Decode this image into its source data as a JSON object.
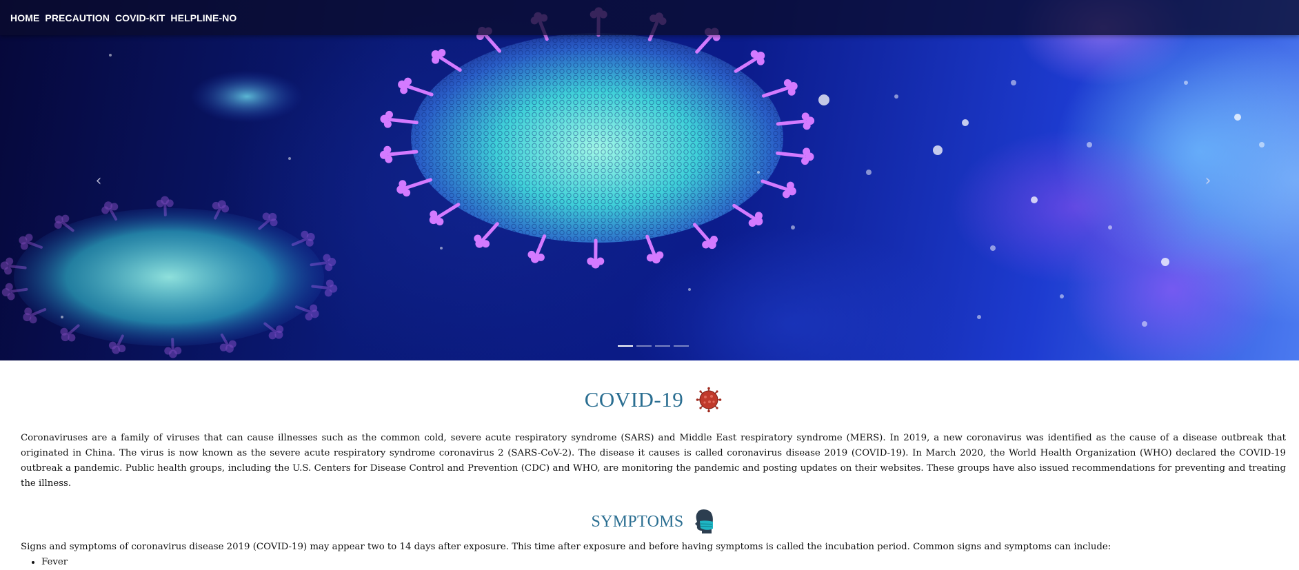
{
  "nav": {
    "items": [
      "HOME",
      "PRECAUTION",
      "COVID-KIT",
      "HELPLINE-NO"
    ]
  },
  "carousel": {
    "prev_icon": "chevron-left-icon",
    "next_icon": "chevron-right-icon",
    "prev_glyph": "‹",
    "next_glyph": "›",
    "slide_count": 4,
    "active_slide": 1
  },
  "covid": {
    "title": "COVID-19",
    "icon": "virus-icon",
    "description": "Coronaviruses are a family of viruses that can cause illnesses such as the common cold, severe acute respiratory syndrome (SARS) and Middle East respiratory syndrome (MERS). In 2019, a new coronavirus was identified as the cause of a disease outbreak that originated in China. The virus is now known as the severe acute respiratory syndrome coronavirus 2 (SARS-CoV-2). The disease it causes is called coronavirus disease 2019 (COVID-19). In March 2020, the World Health Organization (WHO) declared the COVID-19 outbreak a pandemic. Public health groups, including the U.S. Centers for Disease Control and Prevention (CDC) and WHO, are monitoring the pandemic and posting updates on their websites. These groups have also issued recommendations for preventing and treating the illness."
  },
  "symptoms": {
    "title": "SYMPTOMS",
    "icon": "masked-head-icon",
    "intro": "Signs and symptoms of coronavirus disease 2019 (COVID-19) may appear two to 14 days after exposure. This time after exposure and before having symptoms is called the incubation period. Common signs and symptoms can include:",
    "list": [
      "Fever"
    ]
  },
  "colors": {
    "heading": "#2a6e91",
    "nav_bg": "#0a0c2d"
  }
}
